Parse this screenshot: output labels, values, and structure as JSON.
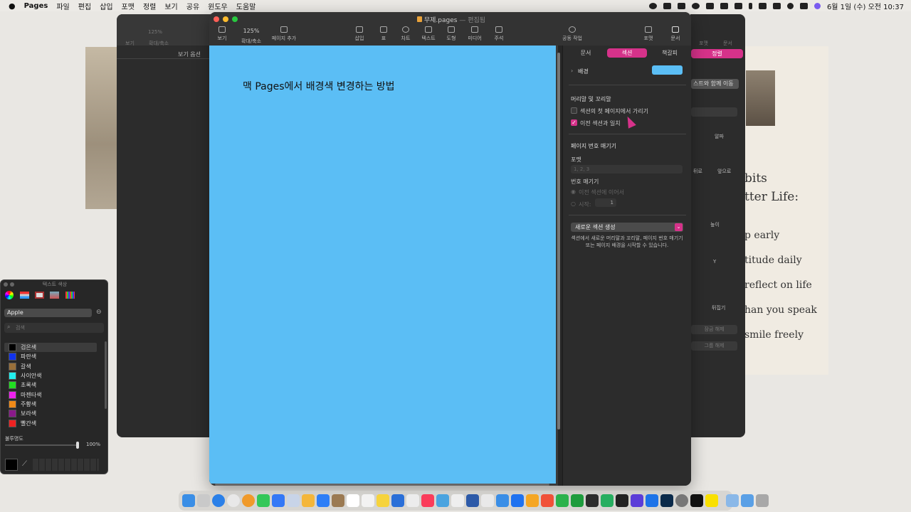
{
  "menubar": {
    "apple_icon": "apple-icon",
    "app_name": "Pages",
    "items": [
      "파일",
      "편집",
      "삽입",
      "포맷",
      "정렬",
      "보기",
      "공유",
      "윈도우",
      "도움말"
    ],
    "clock": "6월 1일 (수) 오전 10:37"
  },
  "window": {
    "title": "무제.pages",
    "subtitle": "— 편집됨",
    "toolbar": {
      "view": "보기",
      "zoom_value": "125%",
      "zoom_label": "확대/축소",
      "add_page": "페이지 추가",
      "insert": "삽입",
      "table": "표",
      "chart": "차트",
      "text": "텍스트",
      "shape": "도형",
      "media": "미디어",
      "comment": "주석",
      "collaborate": "공동 작업",
      "format": "포맷",
      "document": "문서"
    }
  },
  "document": {
    "heading": "맥 Pages에서 배경색 변경하는 방법",
    "background_color": "#5bbef5"
  },
  "sidebar": {
    "tabs": [
      "문서",
      "섹션",
      "책갈피"
    ],
    "active_tab": 1,
    "background_label": "배경",
    "background_swatch": "#5bbef5",
    "header_footer_title": "머리말 및 꼬리말",
    "hide_first_page": "섹션의 첫 페이지에서 가리기",
    "match_previous": "이전 섹션과 일치",
    "page_numbering_title": "페이지 번호 매기기",
    "format_label": "포맷",
    "format_value": "1, 2, 3",
    "numbering_label": "번호 매기기",
    "continue_previous": "이전 섹션에 이어서",
    "start_at_label": "시작:",
    "start_at_value": "1",
    "new_section_button": "새로운 섹션 생성",
    "new_section_desc": "섹션에서 새로운 머리말과 꼬리말, 페이지 번호 매기기 또는 페이지 배경을 시작할 수 있습니다."
  },
  "left_window": {
    "view": "보기",
    "zoom_value": "125%",
    "zoom_label": "확대/축소",
    "view_options": "보기 옵션"
  },
  "right_window": {
    "format": "포맷",
    "document": "문서",
    "arrange_tab": "정렬",
    "move_with_text": "스트와 함께 이동",
    "opacity": "알파",
    "back": "뒤로",
    "front": "앞으로",
    "height": "높이",
    "y": "Y",
    "flip": "뒤집기",
    "lock": "잠금 해제",
    "ungroup": "그룹 해제"
  },
  "wall_paper": {
    "lines": [
      "bits",
      "tter Life:",
      "p early",
      "titude daily",
      "reflect on life",
      "han you speak",
      "smile freely"
    ]
  },
  "color_panel": {
    "title": "텍스트 색상",
    "palette_name": "Apple",
    "search_placeholder": "검색",
    "colors": [
      {
        "name": "검은색",
        "hex": "#000000"
      },
      {
        "name": "파란색",
        "hex": "#1133ee"
      },
      {
        "name": "갈색",
        "hex": "#99703a"
      },
      {
        "name": "사이안색",
        "hex": "#22eeee"
      },
      {
        "name": "초록색",
        "hex": "#22dd22"
      },
      {
        "name": "마젠타색",
        "hex": "#ee22ee"
      },
      {
        "name": "주황색",
        "hex": "#f08a18"
      },
      {
        "name": "보라색",
        "hex": "#8a1a8a"
      },
      {
        "name": "빨간색",
        "hex": "#ee2222"
      }
    ],
    "opacity_label": "불투명도",
    "opacity_value": "100%"
  }
}
